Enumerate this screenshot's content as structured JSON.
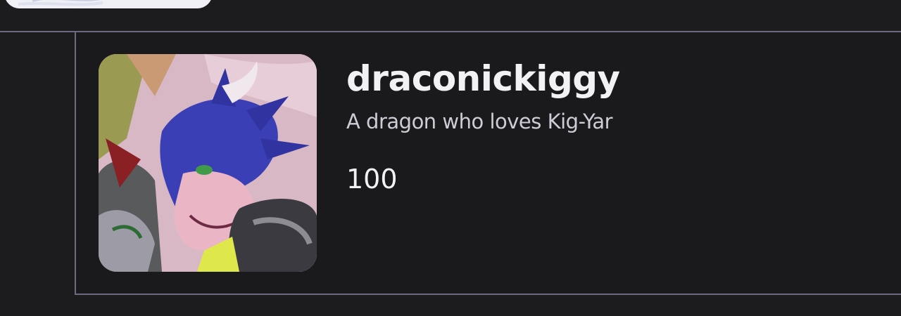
{
  "profile": {
    "username": "draconickiggy",
    "bio": "A dragon who loves Kig-Yar",
    "count": "100",
    "avatar_icon": "dragon-avatar-icon"
  },
  "previous_item": {
    "avatar_icon": "avatar-image-icon"
  },
  "colors": {
    "background": "#1c1b1e",
    "divider": "#6c6a80",
    "text_primary": "#f2f1f4",
    "text_secondary": "#cfccd6"
  }
}
